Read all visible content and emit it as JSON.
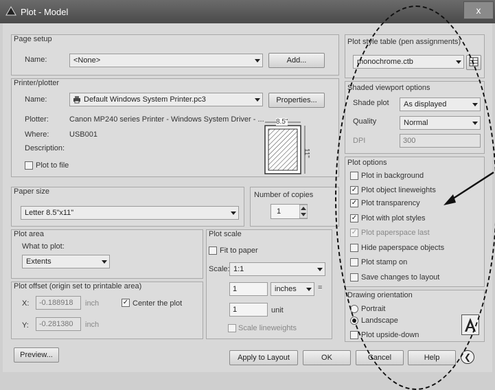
{
  "window": {
    "title": "Plot - Model",
    "close": "x"
  },
  "page_setup": {
    "group_label": "Page setup",
    "name_label": "Name:",
    "name_value": "<None>",
    "add_button": "Add..."
  },
  "printer": {
    "group_label": "Printer/plotter",
    "name_label": "Name:",
    "name_value": "Default Windows System Printer.pc3",
    "properties_button": "Properties...",
    "plotter_label": "Plotter:",
    "plotter_value": "Canon MP240 series Printer - Windows System Driver - ...",
    "where_label": "Where:",
    "where_value": "USB001",
    "description_label": "Description:",
    "plot_to_file": "Plot to file",
    "preview_width": "8.5\"",
    "preview_height": "11\""
  },
  "paper_size": {
    "group_label": "Paper size",
    "value": "Letter 8.5\"x11\""
  },
  "copies": {
    "label": "Number of copies",
    "value": "1"
  },
  "plot_area": {
    "group_label": "Plot area",
    "what_label": "What to plot:",
    "value": "Extents"
  },
  "plot_scale": {
    "group_label": "Plot scale",
    "fit_to_paper": "Fit to paper",
    "scale_label": "Scale:",
    "scale_value": "1:1",
    "value1": "1",
    "unit1": "inches",
    "equals": "=",
    "value2": "1",
    "unit2": "unit",
    "scale_lineweights": "Scale lineweights"
  },
  "plot_offset": {
    "group_label": "Plot offset (origin set to printable area)",
    "x_label": "X:",
    "x_value": "-0.188918",
    "x_unit": "inch",
    "center_plot": "Center the plot",
    "y_label": "Y:",
    "y_value": "-0.281380",
    "y_unit": "inch"
  },
  "plot_style": {
    "group_label": "Plot style table (pen assignments)",
    "value": "monochrome.ctb"
  },
  "shaded": {
    "group_label": "Shaded viewport options",
    "shade_label": "Shade plot",
    "shade_value": "As displayed",
    "quality_label": "Quality",
    "quality_value": "Normal",
    "dpi_label": "DPI",
    "dpi_value": "300"
  },
  "plot_options": {
    "group_label": "Plot options",
    "items": [
      {
        "label": "Plot in background",
        "checked": false,
        "disabled": false
      },
      {
        "label": "Plot object lineweights",
        "checked": true,
        "disabled": false
      },
      {
        "label": "Plot transparency",
        "checked": true,
        "disabled": false
      },
      {
        "label": "Plot with plot styles",
        "checked": true,
        "disabled": false
      },
      {
        "label": "Plot paperspace last",
        "checked": true,
        "disabled": true
      },
      {
        "label": "Hide paperspace objects",
        "checked": false,
        "disabled": false
      },
      {
        "label": "Plot stamp on",
        "checked": false,
        "disabled": false
      },
      {
        "label": "Save changes to layout",
        "checked": false,
        "disabled": false
      }
    ]
  },
  "orientation": {
    "group_label": "Drawing orientation",
    "portrait": "Portrait",
    "landscape": "Landscape",
    "upside_down": "Plot upside-down",
    "selected": "Landscape"
  },
  "footer": {
    "preview": "Preview...",
    "apply": "Apply to Layout",
    "ok": "OK",
    "cancel": "Cancel",
    "help": "Help"
  },
  "colors": {
    "titlebar": "#555555",
    "dialog": "#d8d8d8",
    "annotation": "#111111"
  }
}
